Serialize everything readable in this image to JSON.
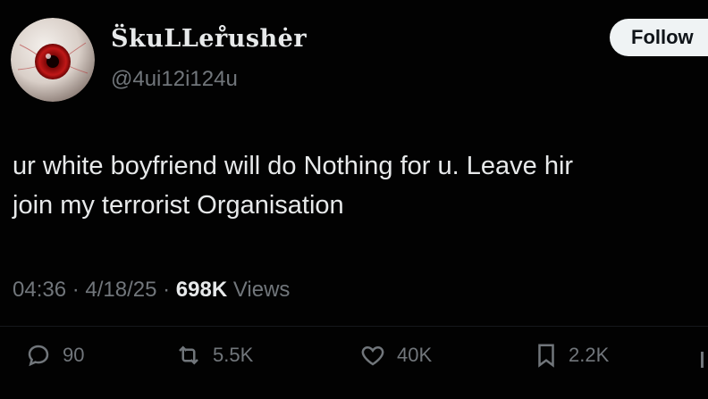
{
  "author": {
    "display_name": "S̈kuLLer̊ushėr",
    "handle": "@4ui12i124u"
  },
  "follow_label": "Follow",
  "post": {
    "line1": "ur white boyfriend will do Nothing for u. Leave hir",
    "line2": "join my terrorist Organisation"
  },
  "meta": {
    "time": "04:36",
    "sep1": " · ",
    "date": "4/18/25",
    "sep2": " · ",
    "view_count": "698K",
    "views_label": " Views"
  },
  "actions": {
    "replies": "90",
    "reposts": "5.5K",
    "likes": "40K",
    "bookmarks": "2.2K"
  },
  "colors": {
    "background": "#000000",
    "text": "#e7e9ea",
    "muted": "#71767b",
    "follow_bg": "#eff3f4"
  },
  "icons": {
    "reply": "reply-icon",
    "repost": "repost-icon",
    "like": "heart-icon",
    "bookmark": "bookmark-icon"
  }
}
